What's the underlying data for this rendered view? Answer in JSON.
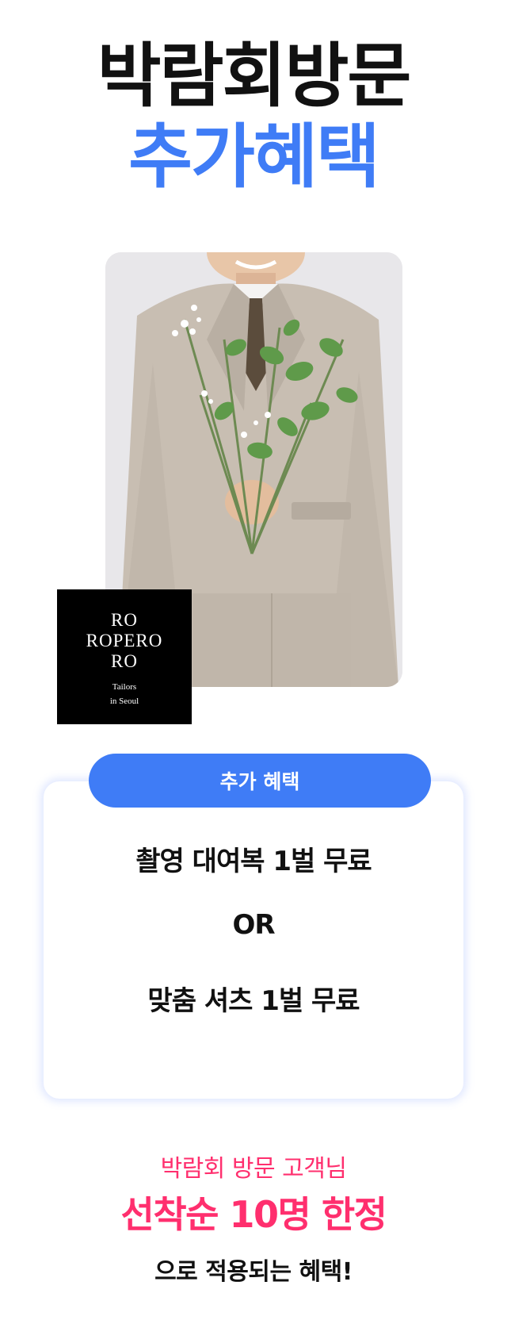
{
  "header": {
    "title_line1": "박람회방문",
    "title_line2": "추가혜택"
  },
  "brand": {
    "line1": "RO",
    "line2": "ROPERO",
    "line3": "RO",
    "sub1": "Tailors",
    "sub2": "in Seoul"
  },
  "benefit": {
    "tag": "추가 혜택",
    "option1": "촬영 대여복 1벌 무료",
    "or": "OR",
    "option2": "맞춤 셔츠 1벌 무료"
  },
  "footer": {
    "line1": "박람회 방문 고객님",
    "line2": "선착순 10명 한정",
    "line3": "으로 적용되는 혜택!"
  },
  "colors": {
    "accent_blue": "#3f7cf6",
    "accent_pink": "#ff2f6e",
    "text_dark": "#111111"
  }
}
